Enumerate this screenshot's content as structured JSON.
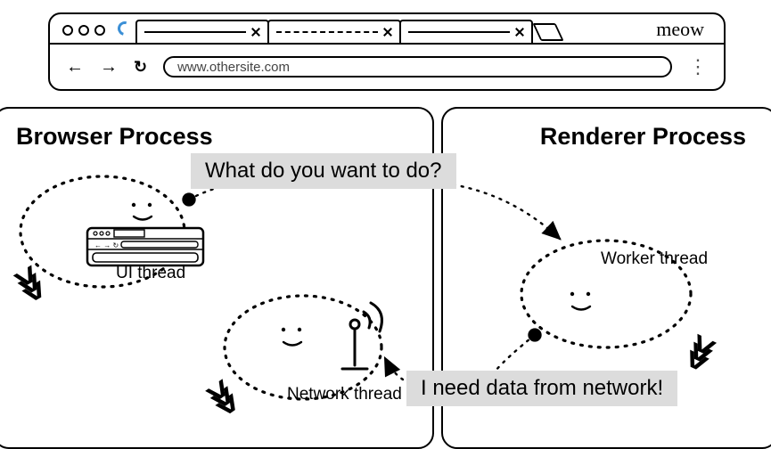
{
  "browser_window": {
    "branding": "meow",
    "url": "www.othersite.com"
  },
  "processes": {
    "browser": {
      "title": "Browser Process"
    },
    "renderer": {
      "title": "Renderer Process"
    }
  },
  "threads": {
    "ui": {
      "label": "UI thread"
    },
    "network": {
      "label": "Network thread"
    },
    "worker": {
      "label": "Worker thread"
    }
  },
  "speech": {
    "question": "What do you want to do?",
    "request": "I need data from network!"
  }
}
